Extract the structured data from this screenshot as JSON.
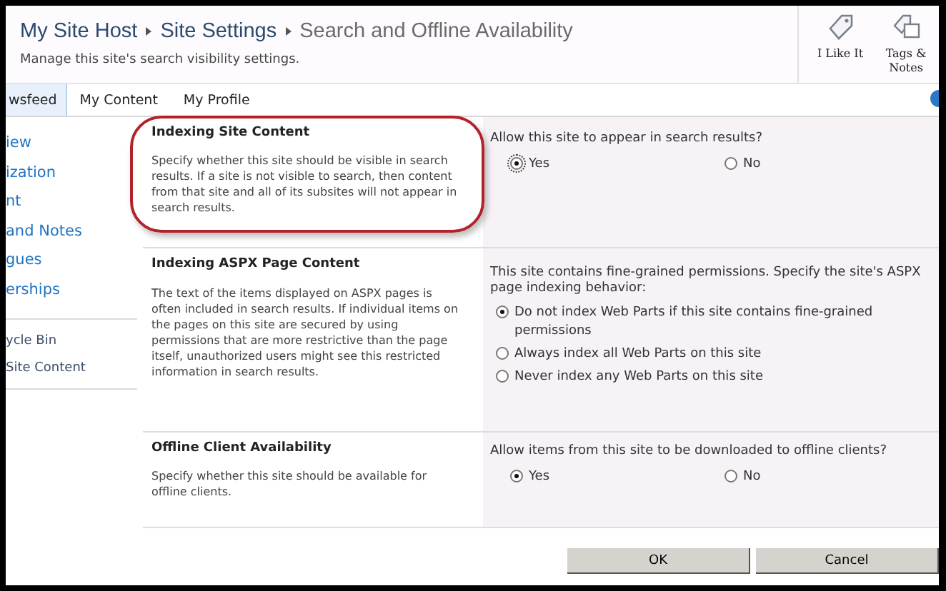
{
  "header": {
    "breadcrumb": [
      "My Site Host",
      "Site Settings",
      "Search and Offline Availability"
    ],
    "subtitle": "Manage this site's search visibility settings.",
    "actions": [
      {
        "label": "I Like It",
        "kind": "tag"
      },
      {
        "label": "Tags &\nNotes",
        "kind": "notes"
      }
    ]
  },
  "tabs": [
    {
      "label": "wsfeed",
      "selected": true
    },
    {
      "label": "My Content",
      "selected": false
    },
    {
      "label": "My Profile",
      "selected": false
    }
  ],
  "sidebar": {
    "items": [
      "iew",
      "ization",
      "nt",
      "and Notes",
      "gues",
      "erships"
    ],
    "bottom_items": [
      "ycle Bin",
      "Site Content"
    ]
  },
  "sections": [
    {
      "title": "Indexing Site Content",
      "description": "Specify whether this site should be visible in search results. If a site is not visible to search, then content from that site and all of its subsites will not appear in search results.",
      "highlighted": true,
      "question": "Allow this site to appear in search results?",
      "kind": "inline",
      "options": [
        {
          "label": "Yes",
          "selected": true
        },
        {
          "label": "No",
          "selected": false
        }
      ]
    },
    {
      "title": "Indexing ASPX Page Content",
      "description": "The text of the items displayed on ASPX pages is often included in search results. If individual items on the pages on this site are secured by using permissions that are more restrictive than the page itself, unauthorized users might see this restricted information in search results.",
      "highlighted": false,
      "question": "This site contains fine-grained permissions. Specify the site's ASPX page indexing behavior:",
      "kind": "stacked",
      "options": [
        {
          "label": "Do not index Web Parts if this site contains fine-grained permissions",
          "selected": true
        },
        {
          "label": "Always index all Web Parts on this site",
          "selected": false
        },
        {
          "label": "Never index any Web Parts on this site",
          "selected": false
        }
      ]
    },
    {
      "title": "Offline Client Availability",
      "description": "Specify whether this site should be available for offline clients.",
      "highlighted": false,
      "question": "Allow items from this site to be downloaded to offline clients?",
      "kind": "inline",
      "options": [
        {
          "label": "Yes",
          "selected": true
        },
        {
          "label": "No",
          "selected": false
        }
      ]
    }
  ],
  "buttons": [
    "OK",
    "Cancel"
  ]
}
